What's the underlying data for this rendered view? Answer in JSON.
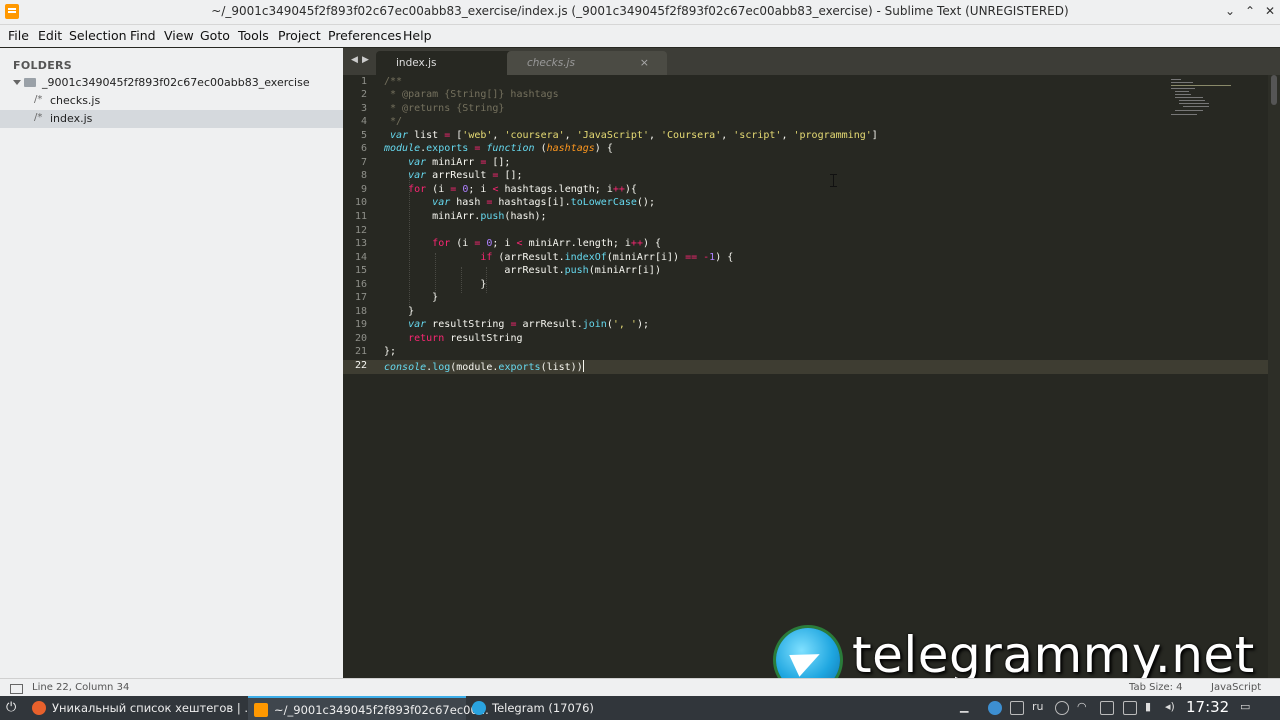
{
  "window": {
    "title": "~/_9001c349045f2f893f02c67ec00abb83_exercise/index.js (_9001c349045f2f893f02c67ec00abb83_exercise) - Sublime Text (UNREGISTERED)",
    "buttons": [
      "chevron-down",
      "chevron-up",
      "close"
    ]
  },
  "menu": [
    "File",
    "Edit",
    "Selection",
    "Find",
    "View",
    "Goto",
    "Tools",
    "Project",
    "Preferences",
    "Help"
  ],
  "sidebar": {
    "title": "FOLDERS",
    "folder": "_9001c349045f2f893f02c67ec00abb83_exercise",
    "files": [
      {
        "label": "checks.js",
        "selected": false
      },
      {
        "label": "index.js",
        "selected": true
      }
    ]
  },
  "tabs": [
    {
      "label": "index.js",
      "active": true,
      "close": "×"
    },
    {
      "label": "checks.js",
      "active": false,
      "close": "×"
    }
  ],
  "editor": {
    "line_numbers": [
      "1",
      "2",
      "3",
      "4",
      "5",
      "6",
      "7",
      "8",
      "9",
      "10",
      "11",
      "12",
      "13",
      "14",
      "15",
      "16",
      "17",
      "18",
      "19",
      "20",
      "21",
      "22"
    ],
    "current_line": 22,
    "colors": {
      "background": "#272822",
      "keyword": "#f92672",
      "string": "#e6db74",
      "comment": "#75715e",
      "number": "#ae81ff",
      "function": "#66d9ef"
    }
  },
  "status": {
    "position": "Line 22, Column 34",
    "tab_size": "Tab Size: 4",
    "syntax": "JavaScript"
  },
  "watermark": {
    "text": "telegrammy.net"
  },
  "taskbar": {
    "tasks": [
      {
        "label": "Уникальный список хештегов | ...",
        "icon": "firefox-icon",
        "active": false
      },
      {
        "label": "~/_9001c349045f2f893f02c67ec00...",
        "icon": "sublime-icon",
        "active": true
      },
      {
        "label": "Telegram (17076)",
        "icon": "telegram-icon",
        "active": false
      }
    ],
    "lang": "ru",
    "clock": "17:32"
  }
}
